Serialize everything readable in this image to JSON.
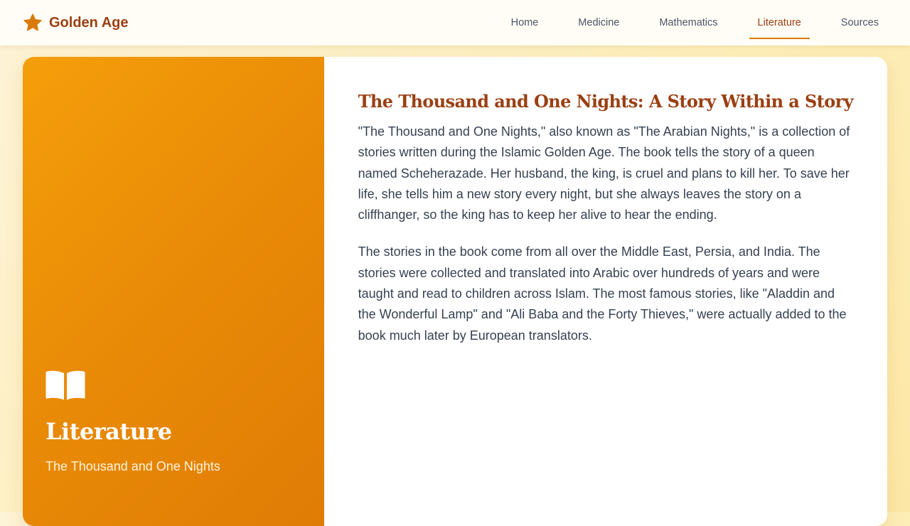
{
  "brand": {
    "name": "Golden Age",
    "icon": "star-icon"
  },
  "nav": {
    "items": [
      {
        "label": "Home"
      },
      {
        "label": "Medicine"
      },
      {
        "label": "Mathematics"
      },
      {
        "label": "Literature",
        "active": true
      },
      {
        "label": "Sources"
      }
    ]
  },
  "hero": {
    "icon": "open-book-icon",
    "title": "Literature",
    "subtitle": "The Thousand and One Nights"
  },
  "article": {
    "title": "The Thousand and One Nights: A Story Within a Story",
    "paragraphs": [
      "\"The Thousand and One Nights,\" also known as \"The Arabian Nights,\" is a collection of stories written during the Islamic Golden Age. The book tells the story of a queen named Scheherazade. Her husband, the king, is cruel and plans to kill her. To save her life, she tells him a new story every night, but she always leaves the story on a cliffhanger, so the king has to keep her alive to hear the ending.",
      "The stories in the book come from all over the Middle East, Persia, and India. The stories were collected and translated into Arabic over hundreds of years and were taught and read to children across Islam. The most famous stories, like \"Aladdin and the Wonderful Lamp\" and \"Ali Baba and the Forty Thieves,\" were actually added to the book much later by European translators."
    ]
  },
  "colors": {
    "brand": "#9a3f12",
    "accent": "#d97a0a",
    "hero_gradient_start": "#f59e0b",
    "hero_gradient_end": "#df7c05"
  }
}
